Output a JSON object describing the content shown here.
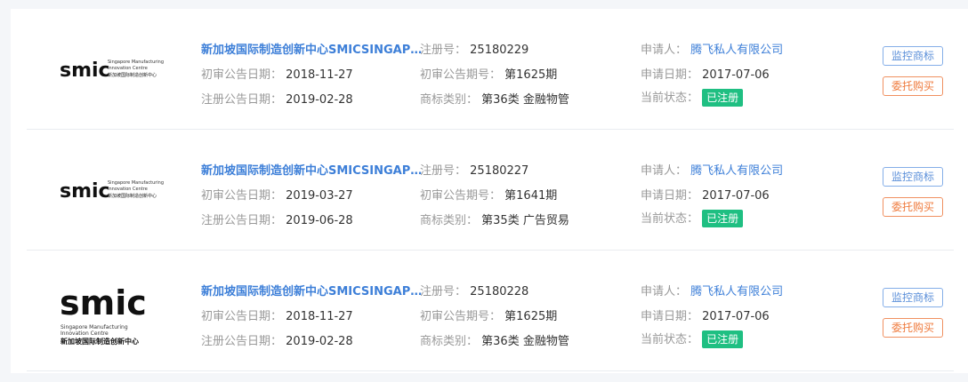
{
  "labels": {
    "reg_no": "注册号：",
    "prelim_date": "初审公告日期：",
    "prelim_no": "初审公告期号：",
    "reg_date": "注册公告日期：",
    "class": "商标类别：",
    "applicant": "申请人：",
    "apply_date": "申请日期：",
    "status": "当前状态："
  },
  "buttons": {
    "monitor": "监控商标",
    "buy": "委托购买"
  },
  "logo": {
    "brand": "smic",
    "sub1": "Singapore Manufacturing",
    "sub2": "Innovation Centre",
    "cn": "新加坡国际制造创新中心"
  },
  "records": [
    {
      "name": "新加坡国际制造创新中心SMICSINGAPORE MANUFACTURING INNOVATION CENTRE",
      "reg_no": "25180229",
      "prelim_date": "2018-11-27",
      "prelim_no": "第1625期",
      "reg_date": "2019-02-28",
      "class": "第36类 金融物管",
      "applicant": "腾飞私人有限公司",
      "apply_date": "2017-07-06",
      "status": "已注册"
    },
    {
      "name": "新加坡国际制造创新中心SMICSINGAPORE MANUFACTURING INNOVATION CENTRE",
      "reg_no": "25180227",
      "prelim_date": "2019-03-27",
      "prelim_no": "第1641期",
      "reg_date": "2019-06-28",
      "class": "第35类 广告贸易",
      "applicant": "腾飞私人有限公司",
      "apply_date": "2017-07-06",
      "status": "已注册"
    },
    {
      "name": "新加坡国际制造创新中心SMICSINGAPORE MANUFACTURING INNOVATION CENTRE",
      "reg_no": "25180228",
      "prelim_date": "2018-11-27",
      "prelim_no": "第1625期",
      "reg_date": "2019-02-28",
      "class": "第36类 金融物管",
      "applicant": "腾飞私人有限公司",
      "apply_date": "2017-07-06",
      "status": "已注册"
    }
  ]
}
